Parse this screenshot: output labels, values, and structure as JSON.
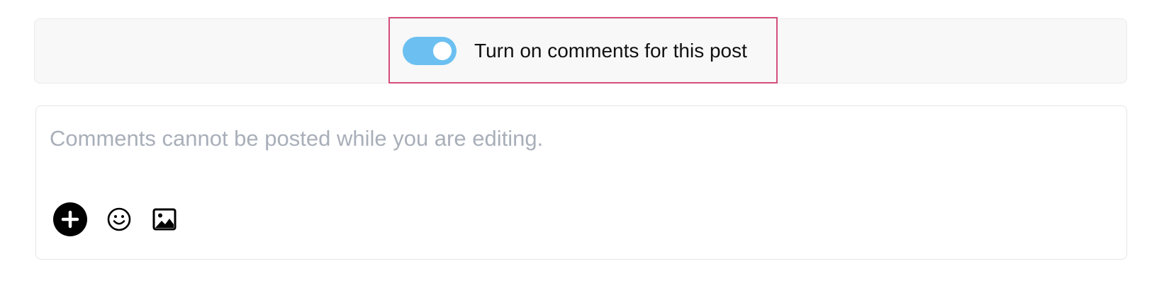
{
  "comments_toggle": {
    "label": "Turn on comments for this post",
    "enabled": true,
    "on_color": "#6cc0f1",
    "highlight_color": "#d34f7e"
  },
  "comment_box": {
    "placeholder": "Comments cannot be posted while you are editing.",
    "value": "",
    "toolbar": {
      "icons": [
        "plus-circle-icon",
        "smiley-icon",
        "image-icon"
      ]
    }
  }
}
